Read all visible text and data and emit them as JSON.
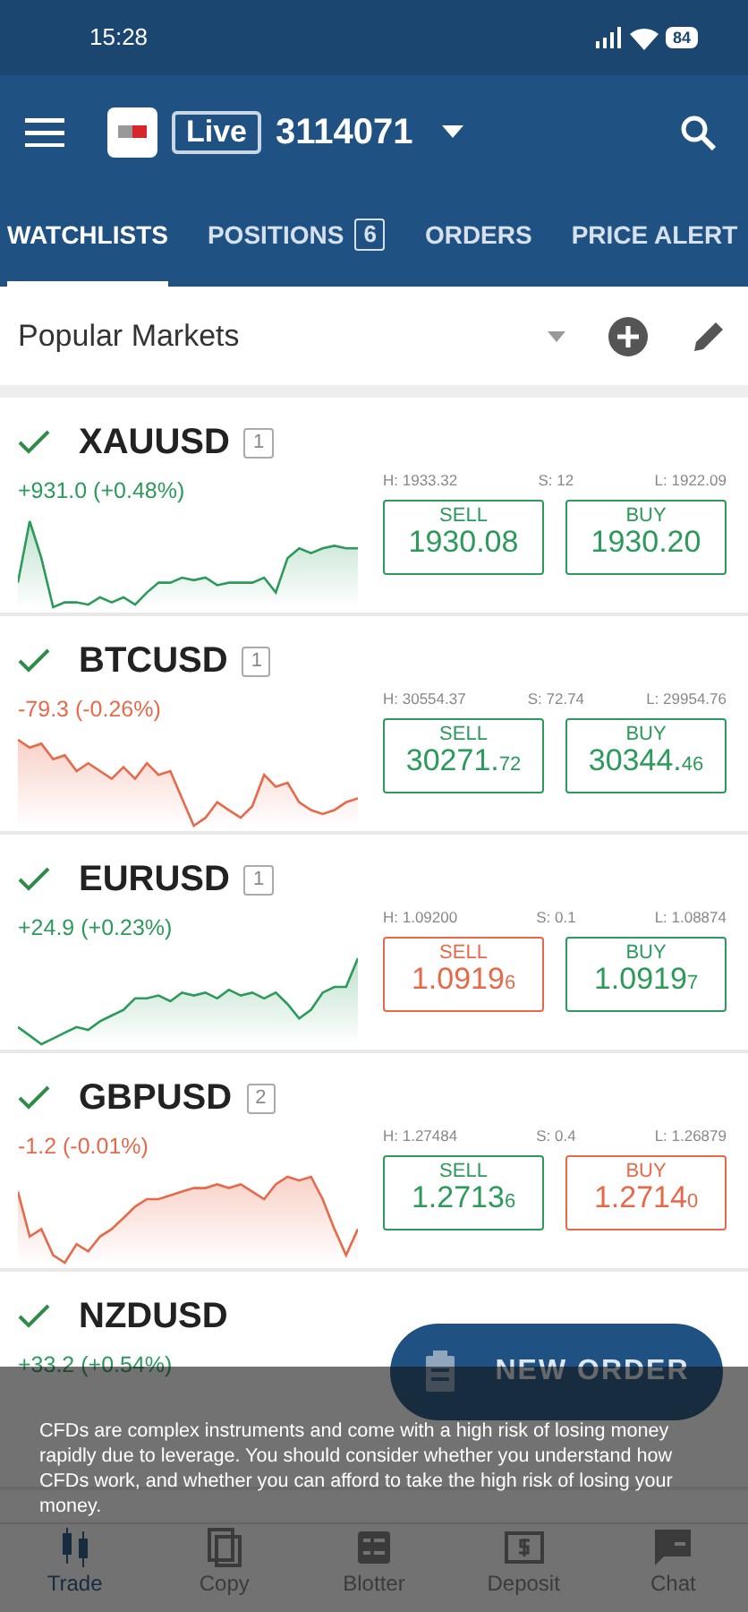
{
  "status_bar": {
    "time": "15:28",
    "battery": "84"
  },
  "app_bar": {
    "mode": "Live",
    "account": "3114071"
  },
  "tabs": [
    {
      "label": "WATCHLISTS",
      "selected": true
    },
    {
      "label": "POSITIONS",
      "badge": "6",
      "selected": false
    },
    {
      "label": "ORDERS",
      "selected": false
    },
    {
      "label": "PRICE ALERT",
      "selected": false
    }
  ],
  "watchlist": {
    "name": "Popular Markets"
  },
  "markets": [
    {
      "symbol": "XAUUSD",
      "count": "1",
      "change": "+931.0 (+0.48%)",
      "color": "#2b9a5a",
      "high": "H: 1933.32",
      "spread": "S: 12",
      "low": "L: 1922.09",
      "sell": {
        "label": "SELL",
        "price": "1930.08",
        "color": "#2b9a5a"
      },
      "buy": {
        "label": "BUY",
        "price": "1930.20",
        "color": "#2b9a5a"
      }
    },
    {
      "symbol": "BTCUSD",
      "count": "1",
      "change": "-79.3 (-0.26%)",
      "color": "#e8694a",
      "high": "H: 30554.37",
      "spread": "S: 72.74",
      "low": "L: 29954.76",
      "sell": {
        "label": "SELL",
        "price": "30271.",
        "pip": "72",
        "color": "#2b9a5a"
      },
      "buy": {
        "label": "BUY",
        "price": "30344.",
        "pip": "46",
        "color": "#2b9a5a"
      }
    },
    {
      "symbol": "EURUSD",
      "count": "1",
      "change": "+24.9 (+0.23%)",
      "color": "#2b9a5a",
      "high": "H: 1.09200",
      "spread": "S: 0.1",
      "low": "L: 1.08874",
      "sell": {
        "label": "SELL",
        "price": "1.0919",
        "pip": "6",
        "color": "#e8694a"
      },
      "buy": {
        "label": "BUY",
        "price": "1.0919",
        "pip": "7",
        "color": "#2b9a5a"
      }
    },
    {
      "symbol": "GBPUSD",
      "count": "2",
      "change": "-1.2 (-0.01%)",
      "color": "#e8694a",
      "high": "H: 1.27484",
      "spread": "S: 0.4",
      "low": "L: 1.26879",
      "sell": {
        "label": "SELL",
        "price": "1.2713",
        "pip": "6",
        "color": "#2b9a5a"
      },
      "buy": {
        "label": "BUY",
        "price": "1.2714",
        "pip": "0",
        "color": "#e8694a"
      }
    },
    {
      "symbol": "NZDUSD",
      "change": "+33.2 (+0.54%)",
      "color": "#2b9a5a"
    }
  ],
  "new_order": {
    "label": "NEW ORDER"
  },
  "disclaimer": "CFDs are complex instruments and come with a high risk of losing money rapidly due to leverage. You should consider whether you understand how CFDs work, and whether you can afford to take the high risk of losing your money.",
  "bottom_nav": [
    {
      "label": "Trade",
      "selected": true
    },
    {
      "label": "Copy",
      "selected": false
    },
    {
      "label": "Blotter",
      "selected": false
    },
    {
      "label": "Deposit",
      "selected": false
    },
    {
      "label": "Chat",
      "selected": false
    }
  ]
}
